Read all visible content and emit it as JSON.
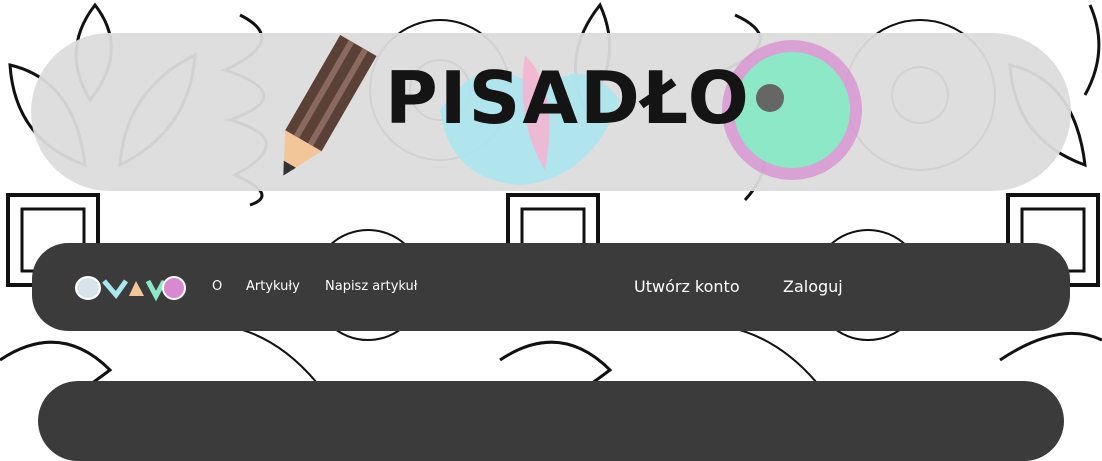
{
  "site": {
    "title": "PISADŁO"
  },
  "nav": {
    "links": [
      {
        "label": "O"
      },
      {
        "label": "Artykuły"
      },
      {
        "label": "Napisz artykuł"
      }
    ],
    "register_label": "Utwórz konto",
    "login_label": "Zaloguj"
  },
  "colors": {
    "nav_bg": "#3b3b3b",
    "banner_bg": "#dcdcdc",
    "pencil": "#5a4036",
    "accent_pink": "#d889d0",
    "accent_mint": "#8de8c8",
    "accent_cyan": "#a8e6f0"
  }
}
